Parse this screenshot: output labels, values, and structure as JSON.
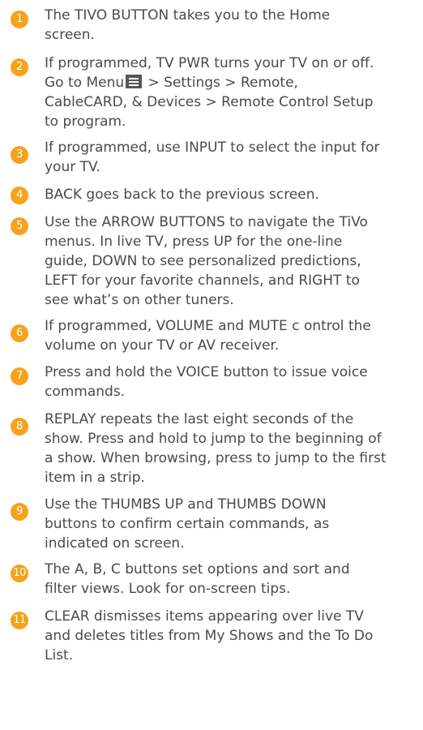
{
  "colors": {
    "orange_badge": "#f5a21c",
    "blue_badge": "#2a9fd8",
    "text": "#4a4a4a",
    "menu_icon": "#575757"
  },
  "items": [
    {
      "number": "1",
      "color": "#f5a21c",
      "text": "The TIVO BUTTON takes you to the Home\nscreen."
    },
    {
      "number": "2",
      "color": "#f5a21c",
      "text_before_icon": "If programmed, TV PWR turns your TV on or off.\nGo to Menu",
      "icon": "menu-icon",
      "text_after_icon": " > Settings > Remote,\nCableCARD, & Devices > Remote Control Setup\nto program."
    },
    {
      "number": "3",
      "color": "#f5a21c",
      "text": "If programmed, use INPUT to select the input for\nyour TV."
    },
    {
      "number": "4",
      "color": "#f5a21c",
      "text": "BACK goes back to the previous screen."
    },
    {
      "number": "5",
      "color": "#f5a21c",
      "text": "Use the ARROW BUTTONS to navigate the TiVo\nmenus. In live TV, press UP for the one-line\nguide, DOWN to see personalized predictions,\nLEFT for your favorite channels, and RIGHT to\nsee what’s on other tuners."
    },
    {
      "number": "6",
      "color": "#f5a21c",
      "text": "If programmed, VOLUME and MUTE c ontrol the\nvolume on your TV or AV receiver."
    },
    {
      "number": "7",
      "color": "#f5a21c",
      "text": "Press and hold the VOICE button to issue voice\ncommands."
    },
    {
      "number": "8",
      "color": "#f5a21c",
      "text": "REPLAY repeats the last eight seconds of the\nshow. Press and hold to jump to the beginning of\na show. When browsing, press to jump to the first\nitem in a strip."
    },
    {
      "number": "9",
      "color": "#f5a21c",
      "text": "Use the THUMBS UP and THUMBS DOWN\nbuttons to confirm certain commands, as\nindicated on screen."
    },
    {
      "number": "10",
      "color": "#f5a21c",
      "text": "The A, B, C buttons set options and sort and\nfilter views. Look for on-screen tips."
    },
    {
      "number": "11",
      "color": "#f5a21c",
      "text": "CLEAR dismisses items appearing over live TV\nand deletes titles from My Shows and the To Do\nList."
    }
  ]
}
